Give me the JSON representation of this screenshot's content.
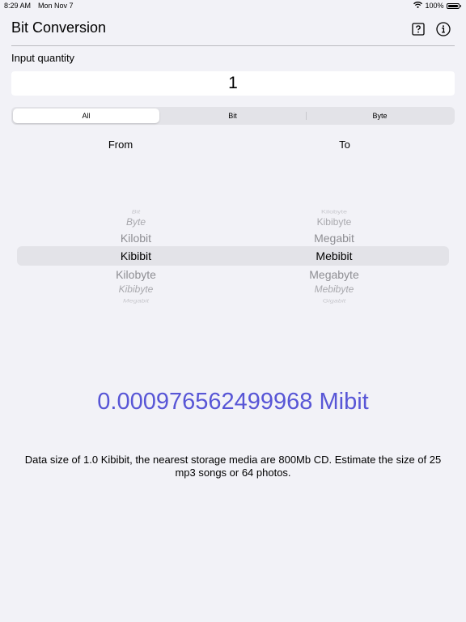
{
  "status_bar": {
    "time": "8:29 AM",
    "date": "Mon Nov 7",
    "battery": "100%"
  },
  "header": {
    "title": "Bit Conversion",
    "help_icon": "question-mark-box-icon",
    "info_icon": "info-circle-icon"
  },
  "input": {
    "label": "Input quantity",
    "value": "1"
  },
  "segments": [
    {
      "label": "All",
      "selected": true
    },
    {
      "label": "Bit",
      "selected": false
    },
    {
      "label": "Byte",
      "selected": false
    }
  ],
  "picker": {
    "from_label": "From",
    "to_label": "To",
    "from_items": [
      "Bit",
      "Byte",
      "Kilobit",
      "Kibibit",
      "Kilobyte",
      "Kibibyte",
      "Megabit"
    ],
    "from_selected": "Kibibit",
    "to_items": [
      "Kilobyte",
      "Kibibyte",
      "Megabit",
      "Mebibit",
      "Megabyte",
      "Mebibyte",
      "Gigabit"
    ],
    "to_selected": "Mebibit"
  },
  "result": "0.000976562499968 Mibit",
  "description": "Data size of 1.0 Kibibit, the nearest storage media are 800Mb CD. Estimate the size of 25 mp3 songs or 64 photos.",
  "colors": {
    "background": "#f2f2f7",
    "accent": "#5856d6",
    "picker_inactive": "#8e8e93"
  }
}
